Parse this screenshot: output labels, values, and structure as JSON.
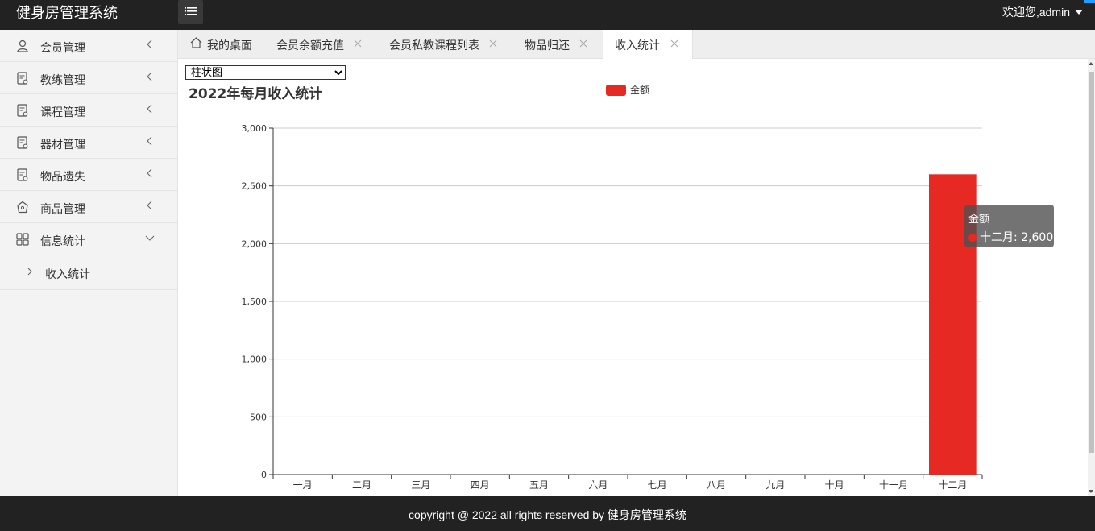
{
  "app": {
    "title": "健身房管理系统",
    "user_greeting": "欢迎您,admin"
  },
  "sidebar": {
    "items": [
      {
        "label": "会员管理",
        "icon": "user-icon"
      },
      {
        "label": "教练管理",
        "icon": "document-icon"
      },
      {
        "label": "课程管理",
        "icon": "document-icon"
      },
      {
        "label": "器材管理",
        "icon": "document-icon"
      },
      {
        "label": "物品遗失",
        "icon": "document-icon"
      },
      {
        "label": "商品管理",
        "icon": "bag-icon"
      },
      {
        "label": "信息统计",
        "icon": "grid-icon",
        "expanded": true
      }
    ],
    "subitems": [
      {
        "label": "收入统计"
      }
    ]
  },
  "tabs": [
    {
      "label": "我的桌面",
      "icon": "home-icon"
    },
    {
      "label": "会员余额充值",
      "closable": true
    },
    {
      "label": "会员私教课程列表",
      "closable": true
    },
    {
      "label": "物品归还",
      "closable": true
    },
    {
      "label": "收入统计",
      "closable": true,
      "active": true
    }
  ],
  "main": {
    "chart_select": {
      "value": "柱状图",
      "options": [
        "柱状图"
      ]
    },
    "tooltip": {
      "series": "金额",
      "label": "十二月: 2,600"
    }
  },
  "chart_data": {
    "type": "bar",
    "title": "2022年每月收入统计",
    "categories": [
      "一月",
      "二月",
      "三月",
      "四月",
      "五月",
      "六月",
      "七月",
      "八月",
      "九月",
      "十月",
      "十一月",
      "十二月"
    ],
    "series": [
      {
        "name": "金额",
        "values": [
          0,
          0,
          0,
          0,
          0,
          0,
          0,
          0,
          0,
          0,
          0,
          2600
        ],
        "color": "#e62923"
      }
    ],
    "ylim": [
      0,
      3000
    ],
    "yticks": [
      "0",
      "500",
      "1,000",
      "1,500",
      "2,000",
      "2,500",
      "3,000"
    ],
    "xlabel": "",
    "ylabel": "",
    "grid": true,
    "legend": "top-center"
  },
  "footer": {
    "text": "copyright @ 2022 all rights reserved by 健身房管理系统"
  }
}
